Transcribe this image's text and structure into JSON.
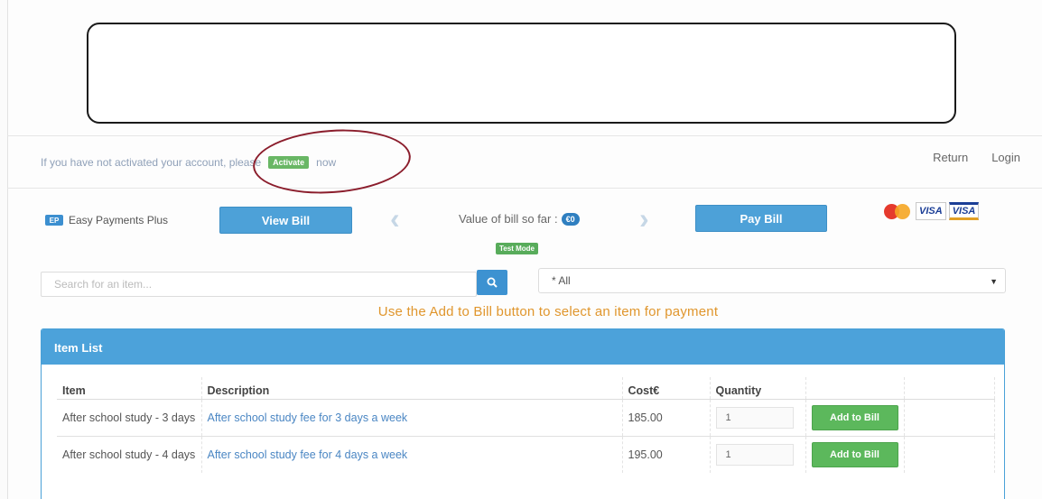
{
  "activation": {
    "prefix": "If you have not activated your account, please",
    "button": "Activate",
    "suffix": "now"
  },
  "nav": {
    "return": "Return",
    "login": "Login"
  },
  "brand": {
    "logo": "EP",
    "name": "Easy Payments Plus"
  },
  "bill": {
    "view_label": "View Bill",
    "value_label": "Value of bill so far :",
    "value": "€0",
    "pay_label": "Pay Bill",
    "mode_badge": "Test Mode"
  },
  "cards": [
    "mastercard",
    "VISA",
    "VISA"
  ],
  "search": {
    "placeholder": "Search for an item...",
    "icon": "search-icon"
  },
  "category": {
    "selected": "* All"
  },
  "instruction": "Use the Add to Bill button to select an item for payment",
  "item_list": {
    "title": "Item List",
    "columns": [
      "Item",
      "Description",
      "Cost€",
      "Quantity",
      ""
    ],
    "rows": [
      {
        "item": "After school study - 3 days",
        "description": "After school study fee for 3 days a week",
        "cost": "185.00",
        "quantity": "1",
        "action": "Add to Bill"
      },
      {
        "item": "After school study - 4 days",
        "description": "After school study fee for 4 days a week",
        "cost": "195.00",
        "quantity": "1",
        "action": "Add to Bill"
      }
    ]
  },
  "colors": {
    "accent": "#4ca2da",
    "success": "#5cb85c",
    "warning": "#e0962d",
    "annotation": "#8b1d2c"
  }
}
